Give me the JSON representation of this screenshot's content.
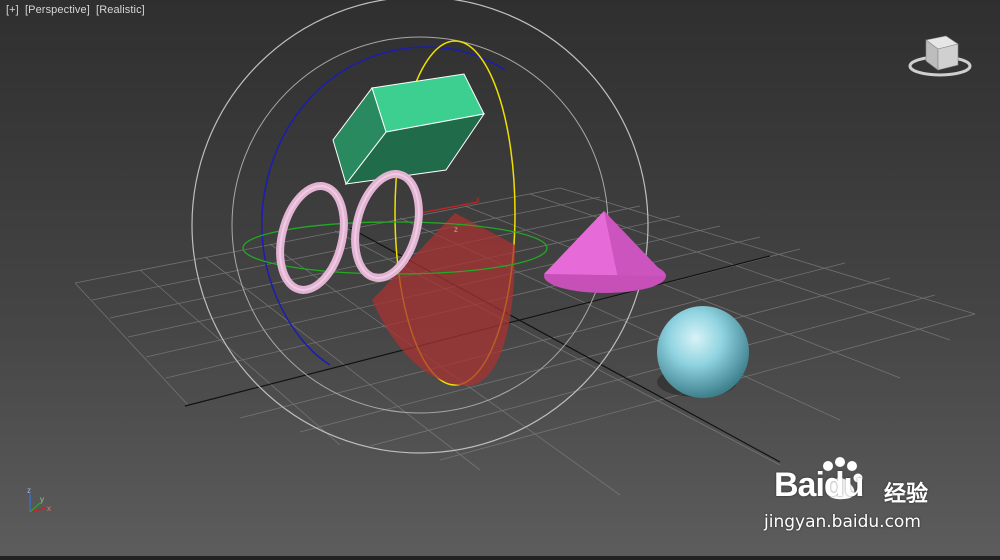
{
  "viewport": {
    "label_plus": "[+]",
    "label_view": "[Perspective]",
    "label_shading": "[Realistic]"
  },
  "gizmo": {
    "rotate_axis_x": "x",
    "rotate_axis_y": "y",
    "rotate_axis_z": "z"
  },
  "axis_tripod": {
    "x": "x",
    "y": "y",
    "z": "z"
  },
  "watermark": {
    "brand": "Baidu",
    "product": "经验",
    "url": "jingyan.baidu.com"
  },
  "colors": {
    "box": "#3cc48a",
    "torus": "#e7b7d6",
    "cone": "#e66bd8",
    "sphere": "#8fd3e0",
    "gizmo_x": "#cc2222",
    "gizmo_y": "#1c1cb3",
    "gizmo_z": "#22aa22",
    "selection": "#f0e000"
  }
}
